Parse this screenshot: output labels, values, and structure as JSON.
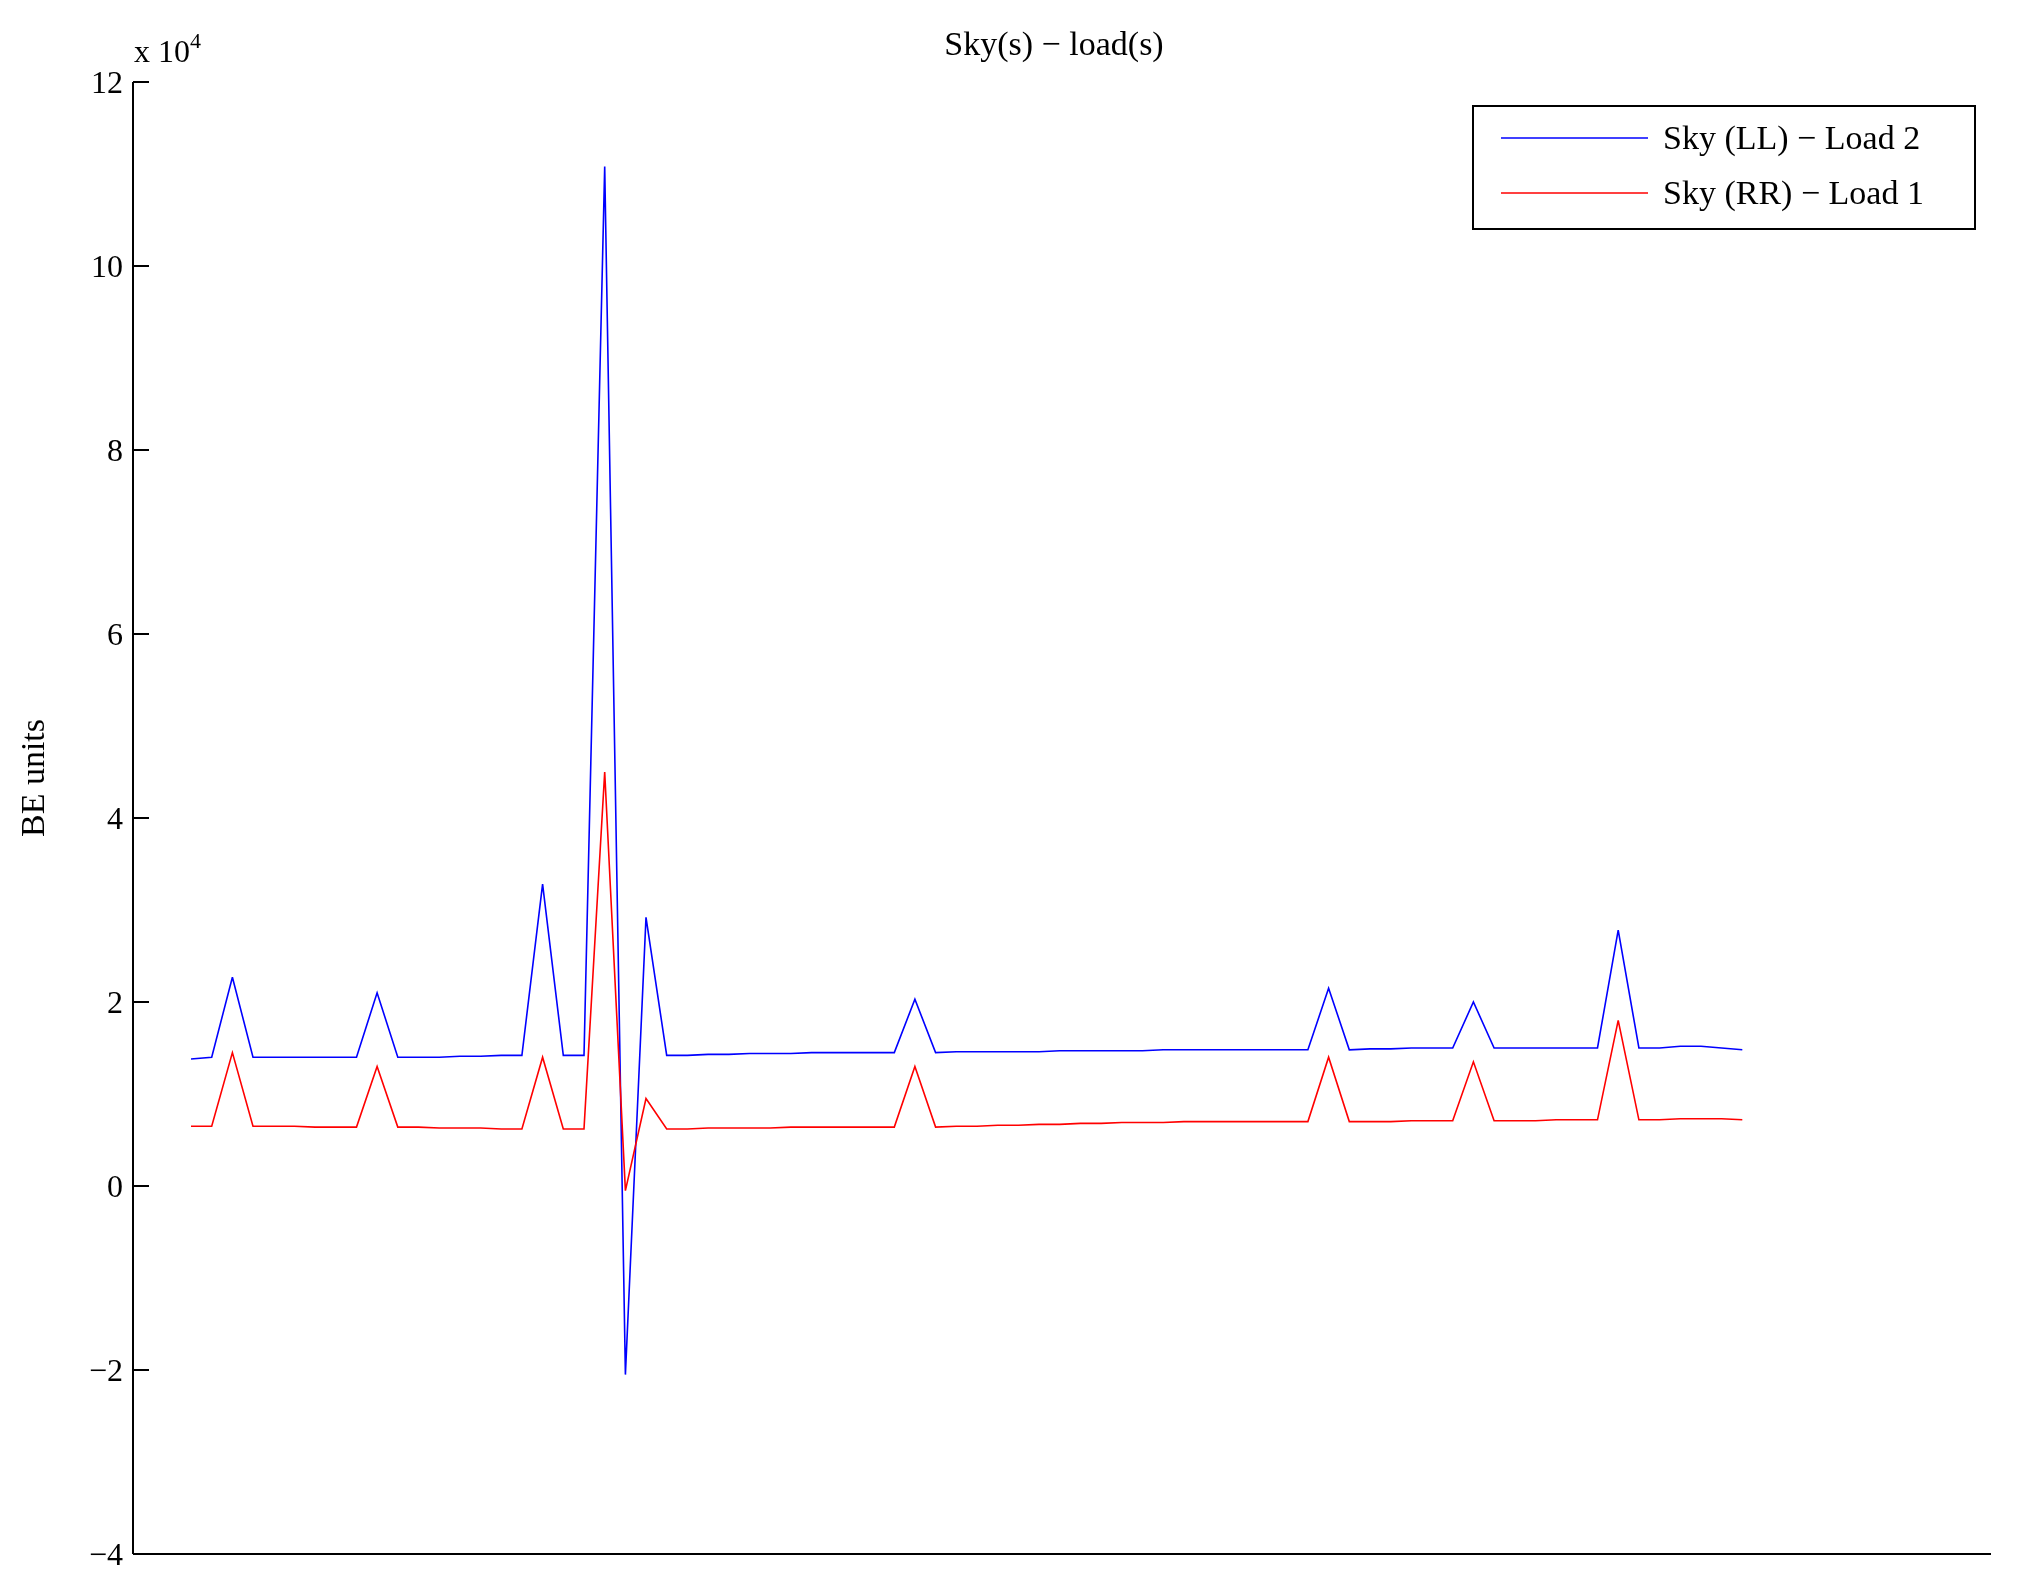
{
  "figure": {
    "y_multiplier": {
      "base": "x 10",
      "exponent": "4"
    },
    "chart_data": {
      "type": "line",
      "title": "Sky(s) − load(s)",
      "ylabel": "BE units",
      "ylim": [
        -4,
        12
      ],
      "legend": true,
      "yticks": [
        {
          "value": -4,
          "label": "−4"
        },
        {
          "value": -2,
          "label": "−2"
        },
        {
          "value": 0,
          "label": "0"
        },
        {
          "value": 2,
          "label": "2"
        },
        {
          "value": 4,
          "label": "4"
        },
        {
          "value": 6,
          "label": "6"
        },
        {
          "value": 8,
          "label": "8"
        },
        {
          "value": 10,
          "label": "10"
        },
        {
          "value": 12,
          "label": "12"
        }
      ],
      "categories": [
        null,
        null,
        null,
        null,
        null,
        null,
        null,
        null,
        null,
        null,
        null,
        null,
        null,
        null,
        null,
        null,
        null,
        null,
        null,
        null,
        null,
        null,
        null,
        null,
        null,
        null,
        null,
        null,
        null,
        null,
        null,
        null,
        null,
        null,
        null,
        null,
        null,
        null,
        null,
        null,
        null,
        null,
        null,
        null,
        null,
        null,
        null,
        null,
        null,
        null,
        null,
        null,
        null,
        null,
        null,
        null,
        null,
        null,
        null,
        null,
        null,
        null,
        null,
        null,
        null,
        null,
        null,
        null,
        null,
        null,
        null,
        null,
        null,
        null,
        null,
        null
      ],
      "series": [
        {
          "name": "Sky (LL) − Load 2",
          "color": "#0000ff",
          "values": [
            1.38,
            1.4,
            2.27,
            1.4,
            1.4,
            1.4,
            1.4,
            1.4,
            1.4,
            2.1,
            1.4,
            1.4,
            1.4,
            1.41,
            1.41,
            1.42,
            1.42,
            3.28,
            1.42,
            1.42,
            11.08,
            -2.05,
            2.92,
            1.42,
            1.42,
            1.43,
            1.43,
            1.44,
            1.44,
            1.44,
            1.45,
            1.45,
            1.45,
            1.45,
            1.45,
            2.03,
            1.45,
            1.46,
            1.46,
            1.46,
            1.46,
            1.46,
            1.47,
            1.47,
            1.47,
            1.47,
            1.47,
            1.48,
            1.48,
            1.48,
            1.48,
            1.48,
            1.48,
            1.48,
            1.48,
            2.15,
            1.48,
            1.49,
            1.49,
            1.5,
            1.5,
            1.5,
            2.0,
            1.5,
            1.5,
            1.5,
            1.5,
            1.5,
            1.5,
            2.78,
            1.5,
            1.5,
            1.52,
            1.52,
            1.5,
            1.48
          ]
        },
        {
          "name": "Sky (RR) − Load 1",
          "color": "#ff0000",
          "values": [
            0.65,
            0.65,
            1.45,
            0.65,
            0.65,
            0.65,
            0.64,
            0.64,
            0.64,
            1.3,
            0.64,
            0.64,
            0.63,
            0.63,
            0.63,
            0.62,
            0.62,
            1.4,
            0.62,
            0.62,
            4.5,
            -0.05,
            0.95,
            0.62,
            0.62,
            0.63,
            0.63,
            0.63,
            0.63,
            0.64,
            0.64,
            0.64,
            0.64,
            0.64,
            0.64,
            1.3,
            0.64,
            0.65,
            0.65,
            0.66,
            0.66,
            0.67,
            0.67,
            0.68,
            0.68,
            0.69,
            0.69,
            0.69,
            0.7,
            0.7,
            0.7,
            0.7,
            0.7,
            0.7,
            0.7,
            1.4,
            0.7,
            0.7,
            0.7,
            0.71,
            0.71,
            0.71,
            1.35,
            0.71,
            0.71,
            0.71,
            0.72,
            0.72,
            0.72,
            1.8,
            0.72,
            0.72,
            0.73,
            0.73,
            0.73,
            0.72
          ]
        }
      ]
    }
  }
}
